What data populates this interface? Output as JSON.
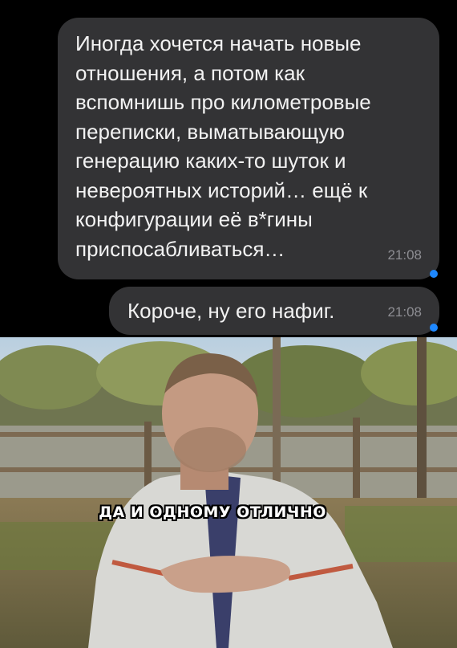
{
  "messages": [
    {
      "text": "Иногда хочется начать новые отношения, а потом как вспомнишь про километровые переписки, выматывающую генерацию каких-то шуток и невероятных историй… ещё к конфигурации её в*гины приспосабливаться…",
      "time": "21:08"
    },
    {
      "text": "Короче, ну его нафиг.",
      "time": "21:08"
    }
  ],
  "meme": {
    "caption": "ДА И ОДНОМУ ОТЛИЧНО"
  },
  "colors": {
    "background": "#000000",
    "bubble": "#333335",
    "bubble_text": "#f2f2f2",
    "time_text": "#8e8e93",
    "unread_dot": "#1e88ff"
  }
}
